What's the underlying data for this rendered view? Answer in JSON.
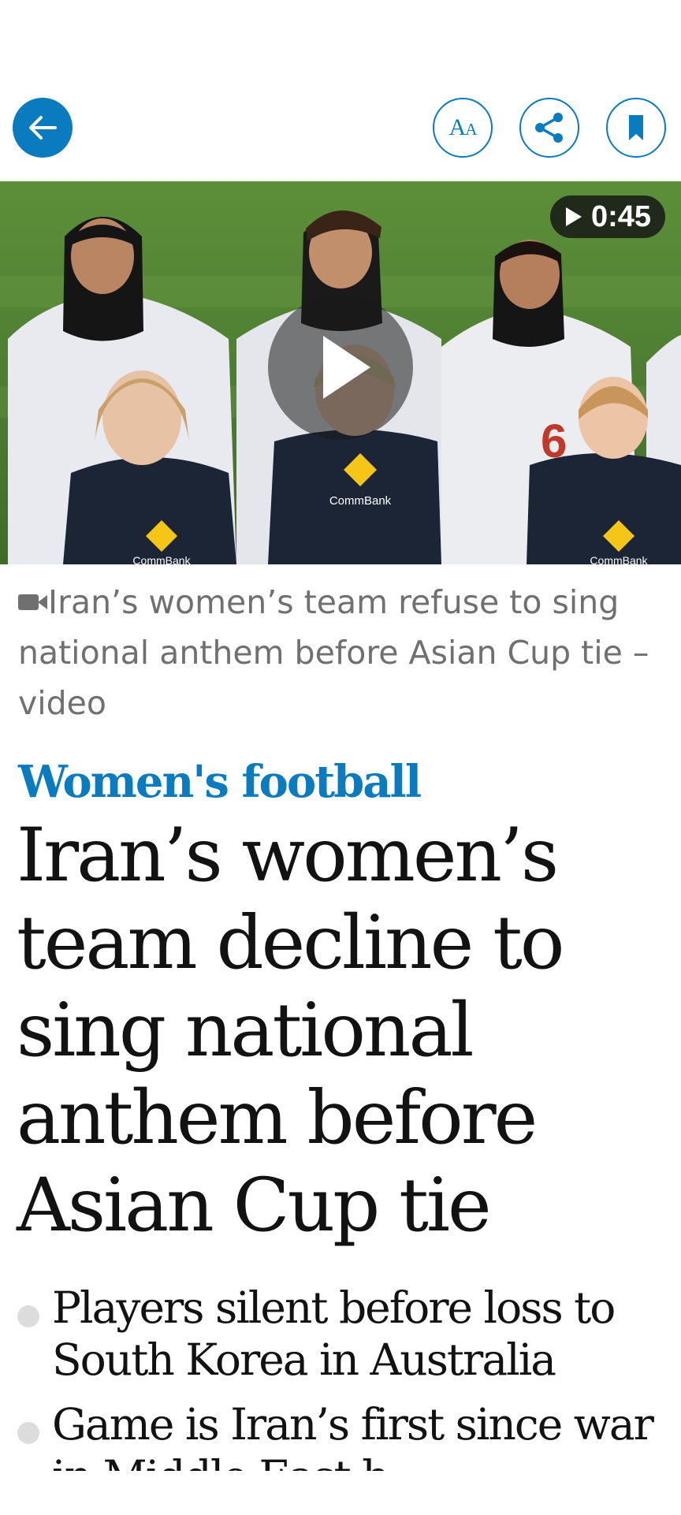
{
  "toolbar": {
    "back_icon": "arrow-left-icon",
    "text_size_icon": "Aa",
    "share_icon": "share-icon",
    "bookmark_icon": "bookmark-icon",
    "accent_color": "#0a7bbf"
  },
  "media": {
    "duration": "0:45",
    "play_icon": "play-icon",
    "sponsor_text": "CommBank",
    "shirt_number": "6"
  },
  "caption": {
    "icon": "video-camera-icon",
    "text": "Iran’s women’s team refuse to sing national anthem before Asian Cup tie – video"
  },
  "article": {
    "kicker": "Women's football",
    "headline": "Iran’s women’s team decline to sing national anthem before Asian Cup tie",
    "standfirst": [
      "Players silent before loss to South Korea in Australia",
      "Game is Iran’s first since war in Middle East b…"
    ]
  }
}
